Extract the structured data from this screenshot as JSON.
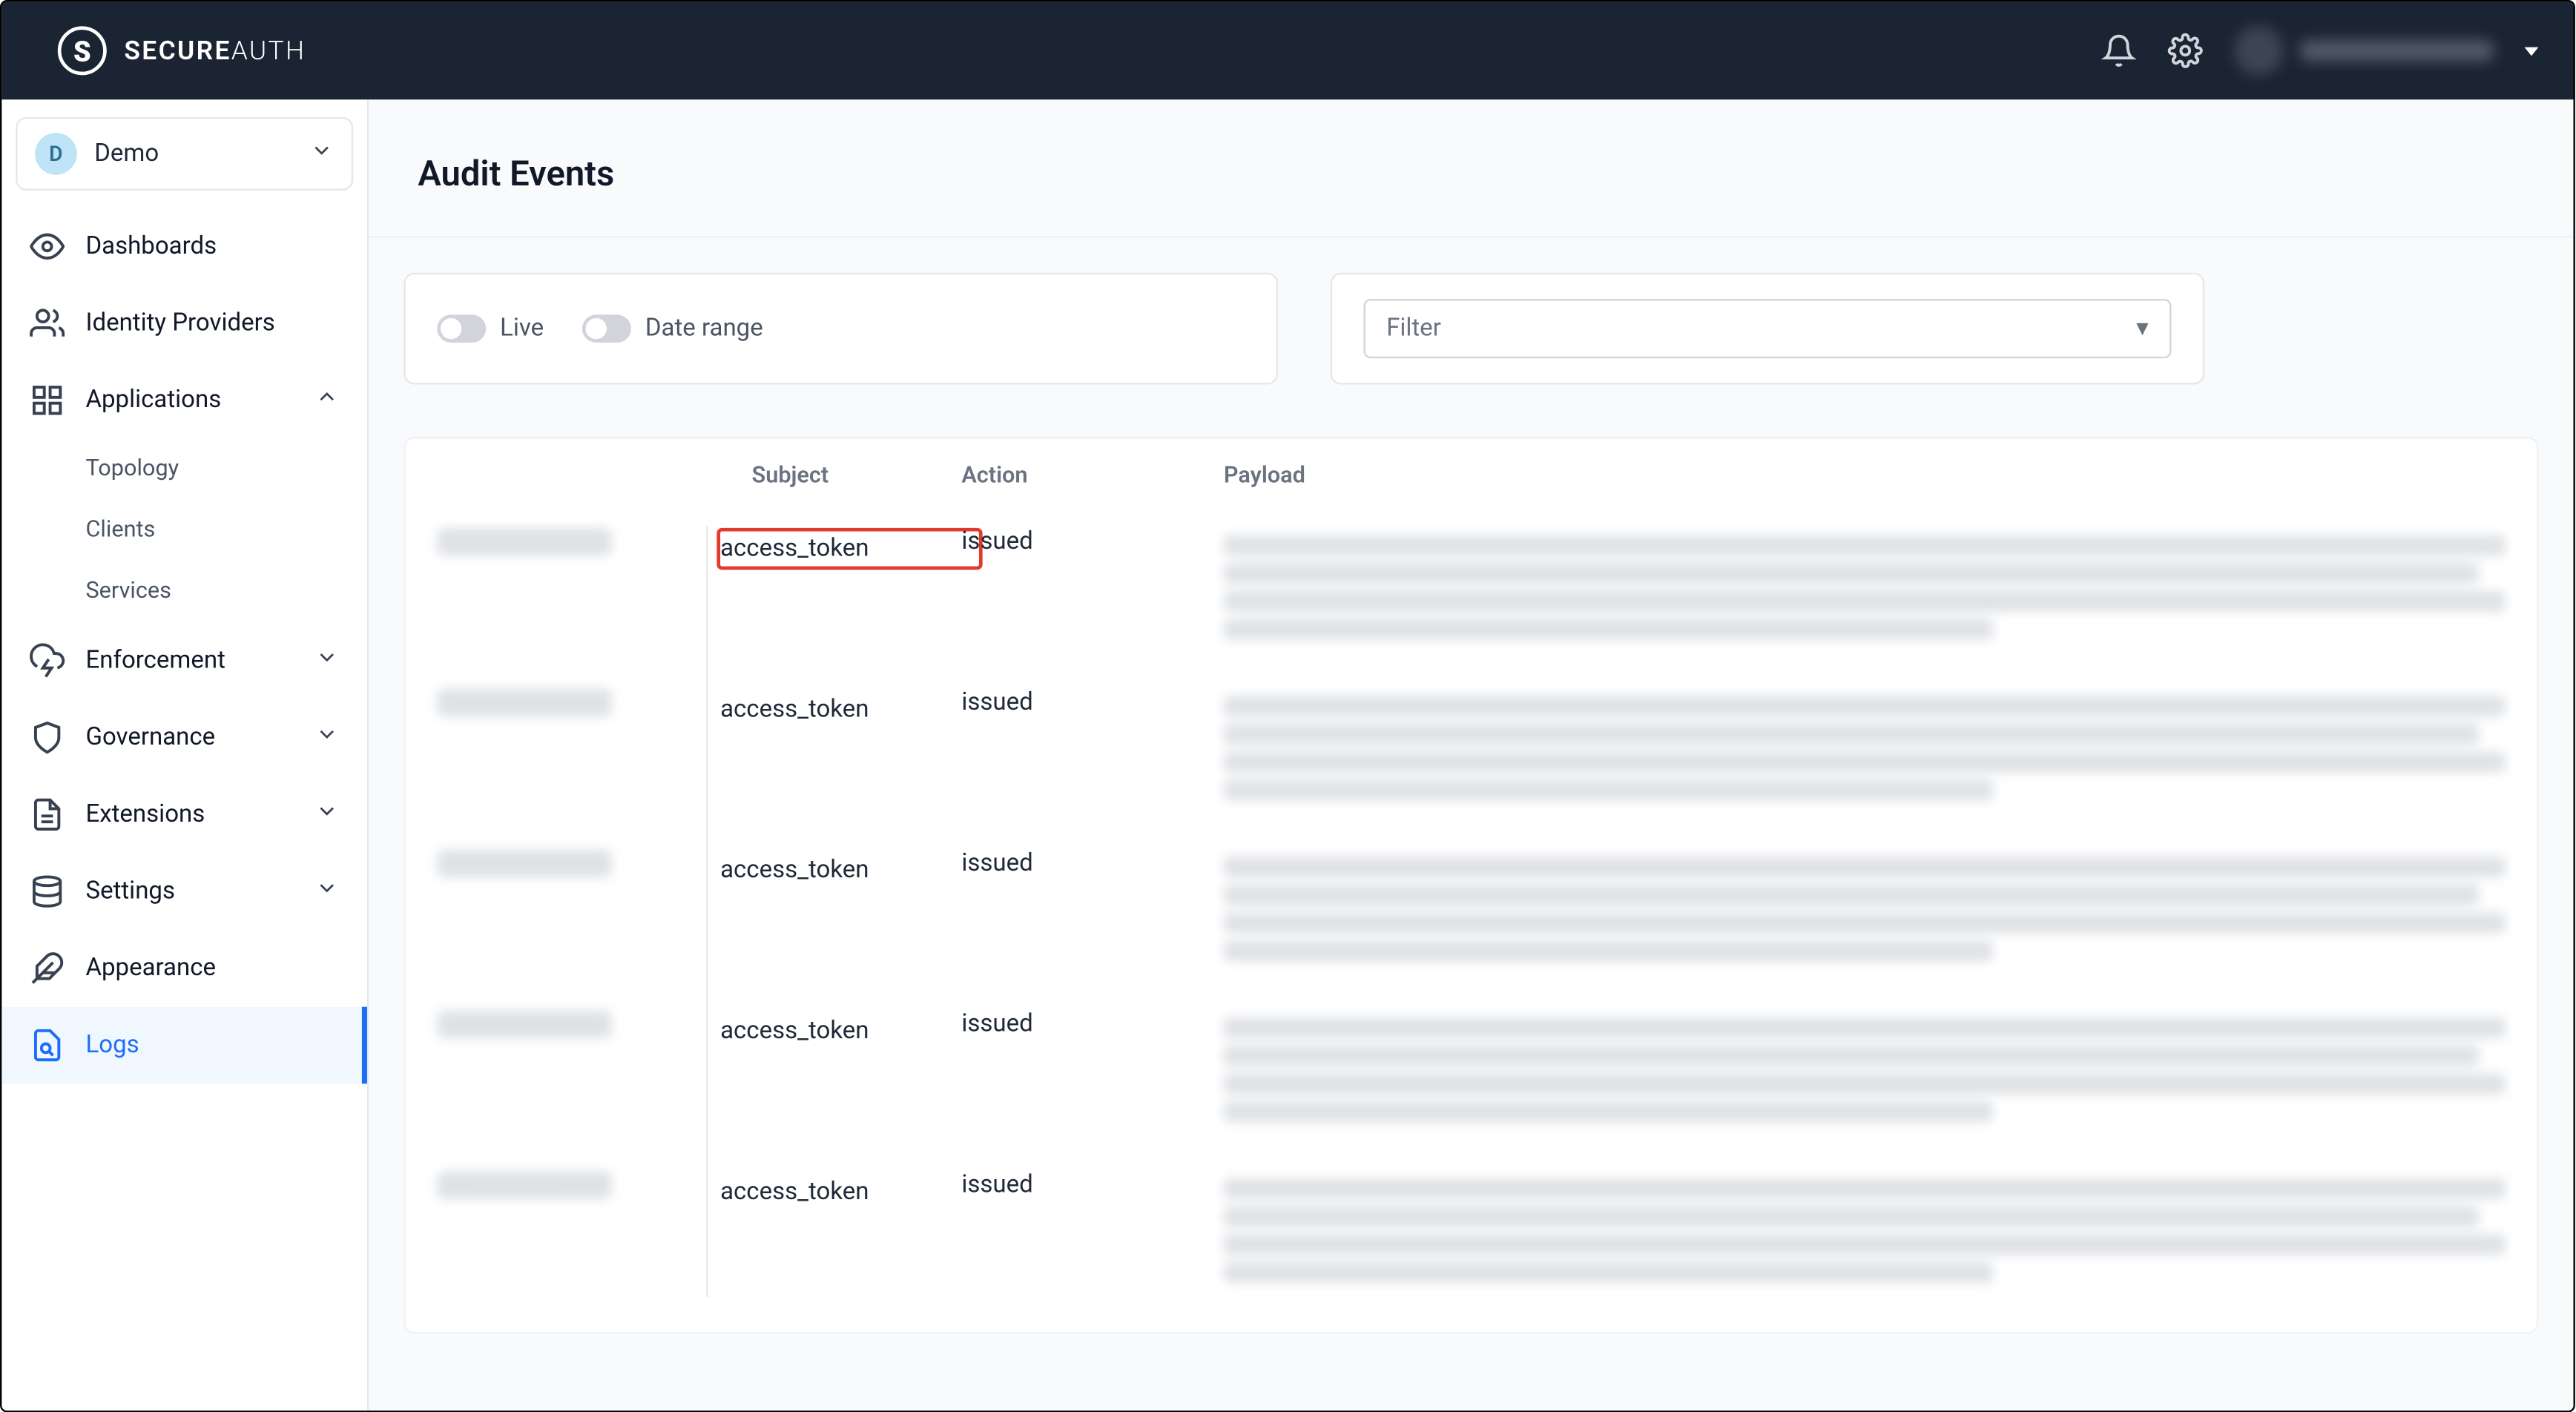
{
  "brand": {
    "strong": "SECURE",
    "light": "AUTH"
  },
  "workspace": {
    "initial": "D",
    "name": "Demo"
  },
  "sidebar": {
    "dashboards": "Dashboards",
    "identity_providers": "Identity Providers",
    "applications": "Applications",
    "applications_sub": {
      "topology": "Topology",
      "clients": "Clients",
      "services": "Services"
    },
    "enforcement": "Enforcement",
    "governance": "Governance",
    "extensions": "Extensions",
    "settings": "Settings",
    "appearance": "Appearance",
    "logs": "Logs"
  },
  "page": {
    "title": "Audit Events"
  },
  "toolbar": {
    "live": "Live",
    "date_range": "Date range",
    "filter_placeholder": "Filter"
  },
  "table": {
    "headers": {
      "subject": "Subject",
      "action": "Action",
      "payload": "Payload"
    },
    "rows": [
      {
        "subject": "access_token",
        "action": "issued",
        "highlight": true
      },
      {
        "subject": "access_token",
        "action": "issued",
        "highlight": false
      },
      {
        "subject": "access_token",
        "action": "issued",
        "highlight": false
      },
      {
        "subject": "access_token",
        "action": "issued",
        "highlight": false
      },
      {
        "subject": "access_token",
        "action": "issued",
        "highlight": false
      }
    ]
  }
}
